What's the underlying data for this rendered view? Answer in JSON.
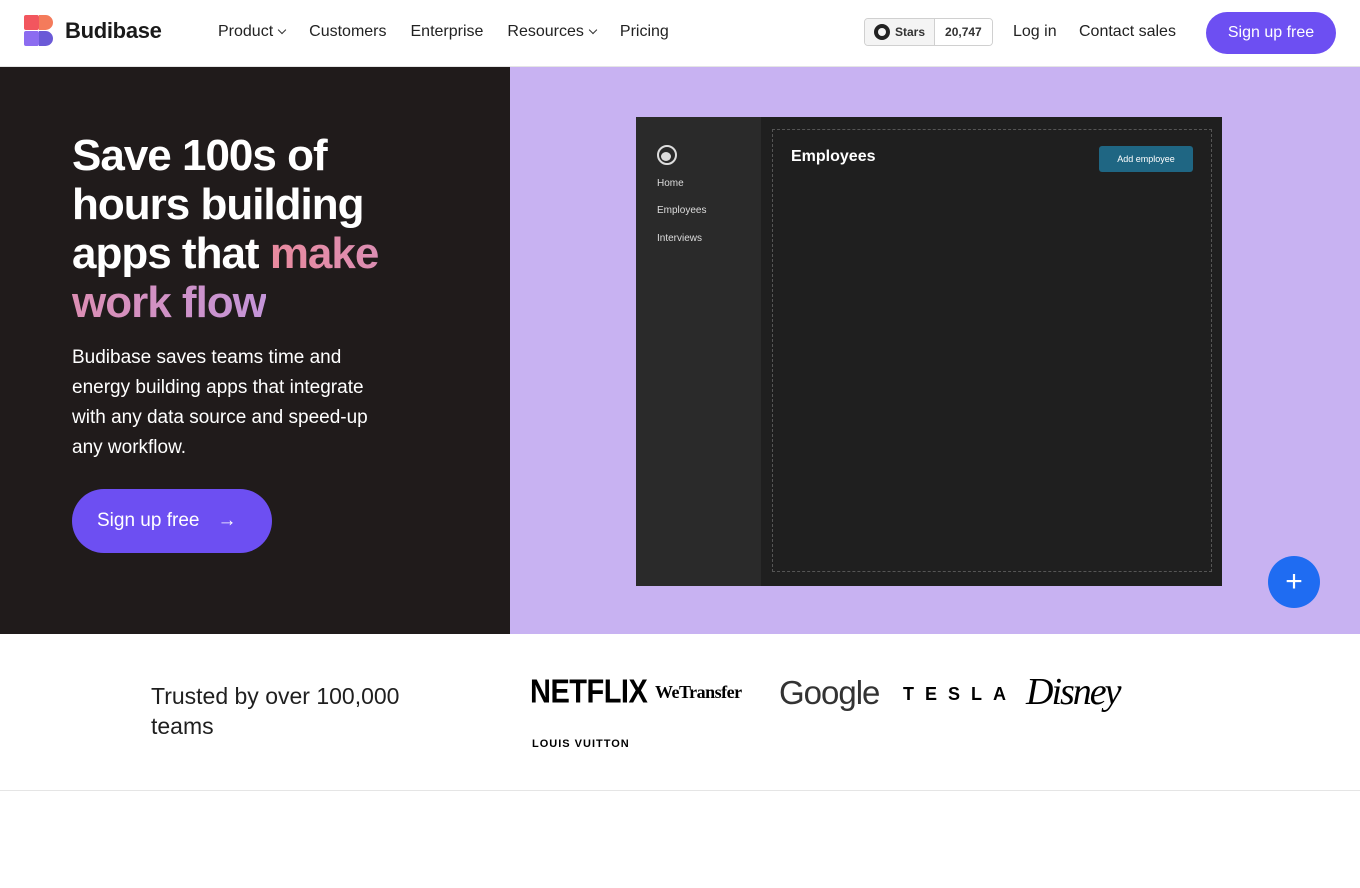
{
  "nav": {
    "brand": "Budibase",
    "menu": [
      {
        "label": "Product",
        "dropdown": true
      },
      {
        "label": "Customers",
        "dropdown": false
      },
      {
        "label": "Enterprise",
        "dropdown": false
      },
      {
        "label": "Resources",
        "dropdown": true
      },
      {
        "label": "Pricing",
        "dropdown": false
      }
    ],
    "github_label": "Stars",
    "github_count": "20,747",
    "login": "Log in",
    "contact": "Contact sales",
    "signup": "Sign up free"
  },
  "hero": {
    "title_plain": "Save 100s of hours building apps that",
    "title_highlight": "make work flow",
    "subtitle": "Budibase saves teams time and energy building apps that integrate with any data source and speed-up any workflow.",
    "cta": "Sign up free",
    "cta_arrow": "→"
  },
  "app_preview": {
    "nav": [
      "Home",
      "Employees",
      "Interviews"
    ],
    "title": "Employees",
    "button": "Add employee",
    "fab": "+"
  },
  "trust": {
    "text": "Trusted by over 100,000 teams",
    "brands": [
      "NETFLIX",
      "WeTransfer",
      "Google",
      "TESLA",
      "Disney",
      "LOUIS VUITTON"
    ]
  },
  "colors": {
    "accent": "#6d4ff2",
    "hero_dark": "#201b1b",
    "hero_purple": "#c8b2f2",
    "fab_blue": "#1f6cf2"
  }
}
